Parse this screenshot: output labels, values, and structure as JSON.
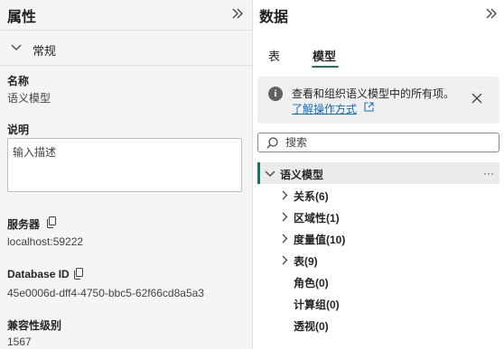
{
  "properties": {
    "title": "属性",
    "section": "常规",
    "fields": {
      "name_label": "名称",
      "name_value": "语义模型",
      "description_label": "说明",
      "description_placeholder": "输入描述",
      "server_label": "服务器",
      "server_value": "localhost:59222",
      "database_label": "Database ID",
      "database_value": "45e0006d-dff4-4750-bbc5-62f66cd8a5a3",
      "compat_label": "兼容性级别",
      "compat_value": "1567"
    }
  },
  "data_pane": {
    "title": "数据",
    "tabs": [
      "表",
      "模型"
    ],
    "active_tab": "模型",
    "info": {
      "text": "查看和组织语义模型中的所有项。",
      "link": "了解操作方式"
    },
    "search_placeholder": "搜索",
    "tree": {
      "root": "语义模型",
      "more": "···",
      "items": [
        {
          "label": "关系(6)",
          "expandable": true
        },
        {
          "label": "区域性(1)",
          "expandable": true
        },
        {
          "label": "度量值(10)",
          "expandable": true
        },
        {
          "label": "表(9)",
          "expandable": true
        },
        {
          "label": "角色(0)",
          "expandable": false
        },
        {
          "label": "计算组(0)",
          "expandable": false
        },
        {
          "label": "透视(0)",
          "expandable": false
        }
      ]
    }
  },
  "colors": {
    "accent": "#117865",
    "link": "#0f6cbd",
    "left_pane_bg": "#f5f5f5"
  },
  "icons": [
    "double-chevron-right-icon",
    "chevron-down-icon",
    "copy-icon",
    "info-icon",
    "external-link-icon",
    "close-icon",
    "search-icon",
    "chevron-right-icon",
    "more-icon"
  ]
}
